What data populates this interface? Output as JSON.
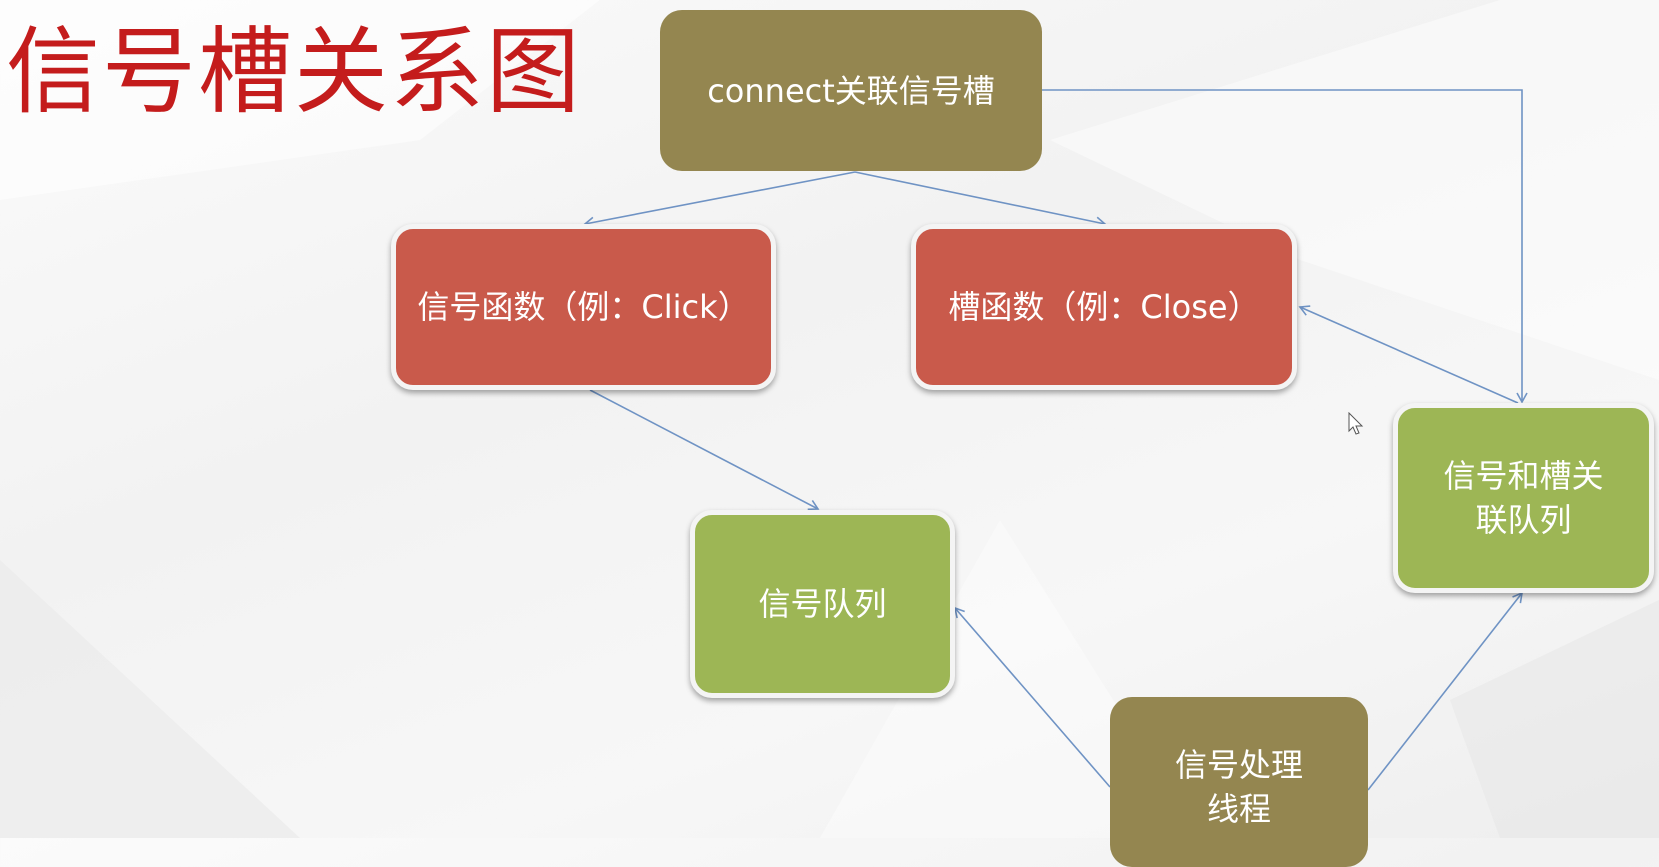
{
  "title": "信号槽关系图",
  "nodes": {
    "connect": "connect关联信号槽",
    "signal_function": "信号函数（例：Click）",
    "slot_function": "槽函数（例：Close）",
    "signal_slot_queue": [
      "信号和槽关",
      "联队列"
    ],
    "signal_queue": "信号队列",
    "signal_thread": [
      "信号处理",
      "线程"
    ]
  },
  "colors": {
    "title": "#c41c1c",
    "olive": "#948650",
    "red": "#c95a4b",
    "green": "#9db655",
    "arrow": "#6f93c4"
  }
}
